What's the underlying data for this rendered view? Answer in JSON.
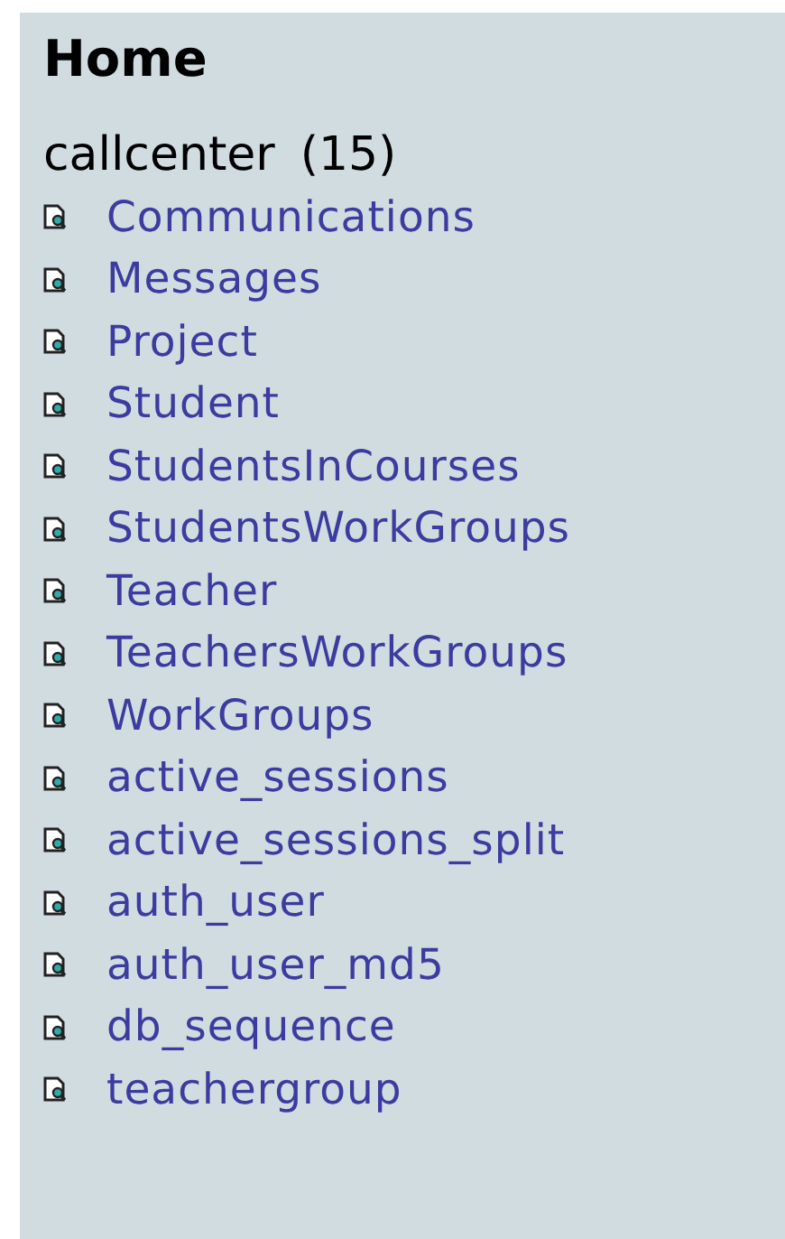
{
  "title": "Home",
  "database": {
    "name": "callcenter",
    "count": "(15)"
  },
  "tables": [
    "Communications",
    "Messages",
    "Project",
    "Student",
    "StudentsInCourses",
    "StudentsWorkGroups",
    "Teacher",
    "TeachersWorkGroups",
    "WorkGroups",
    "active_sessions",
    "active_sessions_split",
    "auth_user",
    "auth_user_md5",
    "db_sequence",
    "teachergroup"
  ]
}
